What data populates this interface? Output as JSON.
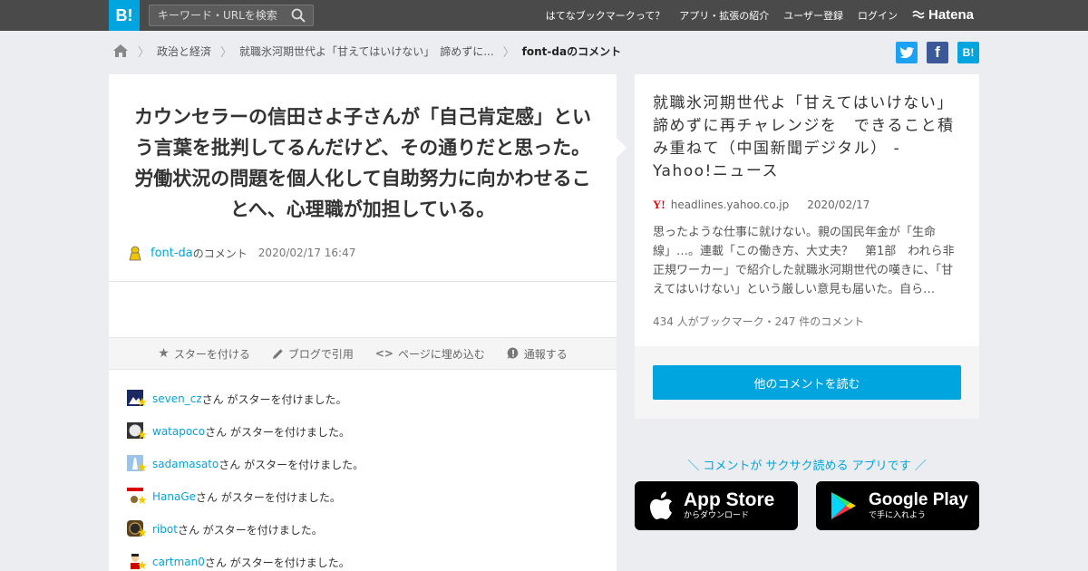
{
  "header": {
    "logo": "B!",
    "search_placeholder": "キーワード・URLを検索",
    "nav": [
      "はてなブックマークって？",
      "アプリ・拡張の紹介",
      "ユーザー登録",
      "ログイン"
    ],
    "brand": "Hatena"
  },
  "breadcrumb": {
    "items": [
      "政治と経済",
      "就職氷河期世代よ「甘えてはいけない」　諦めずに...",
      "font-daのコメント"
    ]
  },
  "share": {
    "twitter_color": "#1da1f2",
    "facebook_color": "#3b5998",
    "hatena_color": "#00a4de"
  },
  "comment": {
    "text": "カウンセラーの信田さよ子さんが「自己肯定感」という言葉を批判してるんだけど、その通りだと思った。労働状況の問題を個人化して自助努力に向かわせることへ、心理職が加担している。",
    "user": "font-da",
    "suffix": "のコメント",
    "datetime": "2020/02/17 16:47"
  },
  "actions": {
    "star": "スターを付ける",
    "blog": "ブログで引用",
    "embed": "ページに埋め込む",
    "report": "通報する"
  },
  "star_suffix": "さん がスターを付けました。",
  "stars": [
    {
      "user": "seven_cz"
    },
    {
      "user": "watapoco"
    },
    {
      "user": "sadamasato"
    },
    {
      "user": "HanaGe"
    },
    {
      "user": "ribot"
    },
    {
      "user": "cartman0"
    }
  ],
  "article": {
    "title": "就職氷河期世代よ「甘えてはいけない」　諦めずに再チャレンジを　できること積み重ねて（中国新聞デジタル） - Yahoo!ニュース",
    "source_logo": "Y!",
    "domain": "headlines.yahoo.co.jp",
    "date": "2020/02/17",
    "excerpt": "思ったような仕事に就けない。親の国民年金が「生命線」…。連載「この働き方、大丈夫？　第1部　われら非正規ワーカー」で紹介した就職氷河期世代の嘆きに、「甘えてはいけない」という厳しい意見も届いた。自ら…",
    "counts": "434 人がブックマーク・247 件のコメント",
    "read_more": "他のコメントを読む"
  },
  "app": {
    "promo": "＼ コメントが サクサク読める アプリです ／",
    "appstore_big": "App Store",
    "appstore_small": "からダウンロード",
    "googleplay_big": "Google Play",
    "googleplay_small": "で手に入れよう"
  },
  "colors": {
    "accent": "#00a4de",
    "star": "#f6c700"
  }
}
